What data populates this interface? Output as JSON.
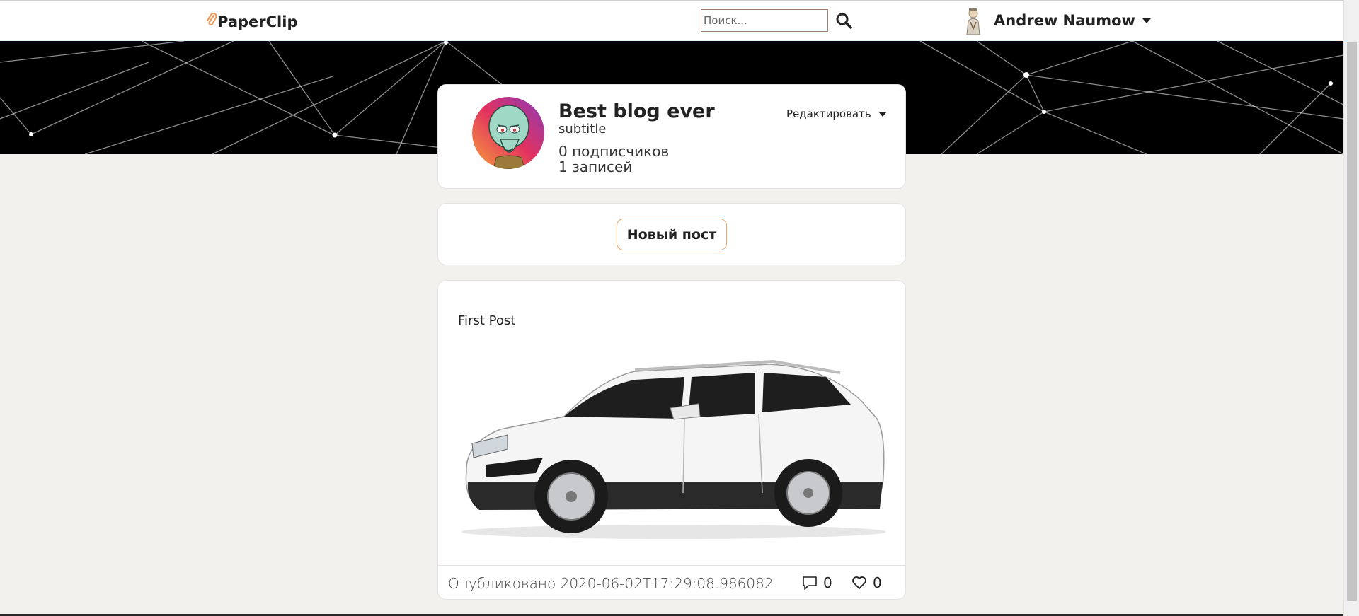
{
  "header": {
    "logo_text": "PaperClip",
    "search_placeholder": "Поиск...",
    "user_name": "Andrew Naumow"
  },
  "profile": {
    "title": "Best blog ever",
    "subtitle": "subtitle",
    "subscribers": "0 подписчиков",
    "posts_count": "1 записей",
    "edit_label": "Редактировать"
  },
  "new_post": {
    "label": "Новый пост"
  },
  "post": {
    "title": "First Post",
    "published": "Опубликовано 2020-06-02T17:29:08.986082",
    "comments": "0",
    "likes": "0"
  },
  "colors": {
    "accent": "#f0a56a",
    "banner": "#000000",
    "page_bg": "#f2f1ee"
  },
  "icons": [
    "paperclip-icon",
    "search-icon",
    "chevron-down-icon",
    "comment-icon",
    "heart-icon"
  ]
}
